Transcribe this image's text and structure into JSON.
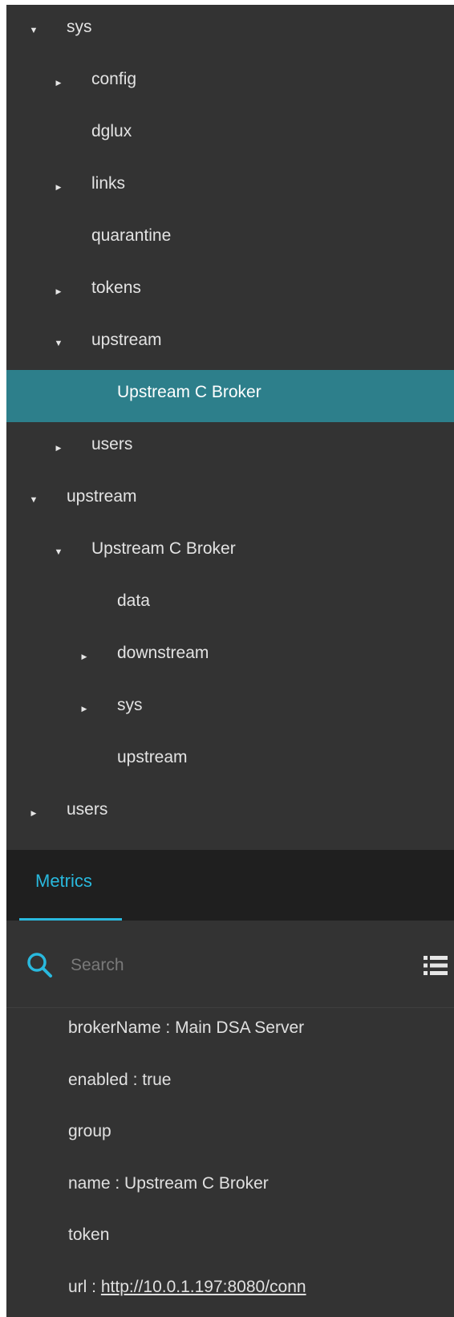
{
  "tree": {
    "rows": [
      {
        "label": "sys",
        "arrow": "▼",
        "depth": 0
      },
      {
        "label": "config",
        "arrow": "▶",
        "depth": 1
      },
      {
        "label": "dglux",
        "arrow": "",
        "depth": 1
      },
      {
        "label": "links",
        "arrow": "▶",
        "depth": 1
      },
      {
        "label": "quarantine",
        "arrow": "",
        "depth": 1
      },
      {
        "label": "tokens",
        "arrow": "▶",
        "depth": 1
      },
      {
        "label": "upstream",
        "arrow": "▼",
        "depth": 1
      },
      {
        "label": "Upstream C Broker",
        "arrow": "",
        "depth": 2,
        "selected": true
      },
      {
        "label": "users",
        "arrow": "▶",
        "depth": 1
      },
      {
        "label": "upstream",
        "arrow": "▼",
        "depth": 0
      },
      {
        "label": "Upstream C Broker",
        "arrow": "▼",
        "depth": 1
      },
      {
        "label": "data",
        "arrow": "",
        "depth": 2
      },
      {
        "label": "downstream",
        "arrow": "▶",
        "depth": 2
      },
      {
        "label": "sys",
        "arrow": "▶",
        "depth": 2
      },
      {
        "label": "upstream",
        "arrow": "",
        "depth": 2
      },
      {
        "label": "users",
        "arrow": "▶",
        "depth": 0
      }
    ]
  },
  "tabs": {
    "metrics_label": "Metrics"
  },
  "search": {
    "placeholder": "Search"
  },
  "metrics": {
    "rows": [
      {
        "key": "brokerName",
        "value": "Main DSA Server"
      },
      {
        "key": "enabled",
        "value": "true"
      },
      {
        "key": "group",
        "value": ""
      },
      {
        "key": "name",
        "value": "Upstream C Broker"
      },
      {
        "key": "token",
        "value": ""
      },
      {
        "key": "url",
        "value": "http://10.0.1.197:8080/conn",
        "link": true
      }
    ]
  },
  "colors": {
    "background": "#333333",
    "selected_row": "#2d7f8b",
    "accent": "#29b9de",
    "tab_bar": "#1f1f1f",
    "text": "#e3e3e3"
  },
  "icons": {
    "expanded": "caret-down-icon",
    "collapsed": "caret-right-icon",
    "search": "search-icon",
    "list": "list-icon"
  }
}
